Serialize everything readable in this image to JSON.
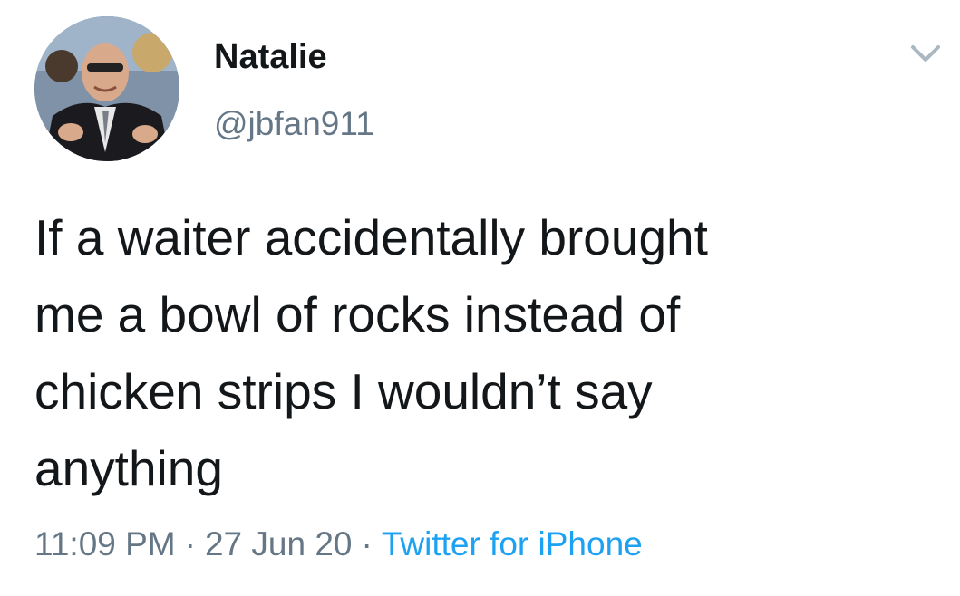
{
  "tweet": {
    "author": {
      "display_name": "Natalie",
      "handle": "@jbfan911",
      "avatar_icon": "profile-photo"
    },
    "menu_icon": "chevron-down-icon",
    "text_lines": [
      "If a waiter accidentally brought",
      "me a bowl of rocks instead of",
      "chicken strips I wouldn’t say",
      "anything"
    ],
    "time": "11:09 PM",
    "date": "27 Jun 20",
    "separator": "·",
    "source": "Twitter for iPhone"
  },
  "colors": {
    "text": "#14171a",
    "secondary": "#657786",
    "link": "#1da1f2",
    "chevron": "#aab8c2"
  }
}
